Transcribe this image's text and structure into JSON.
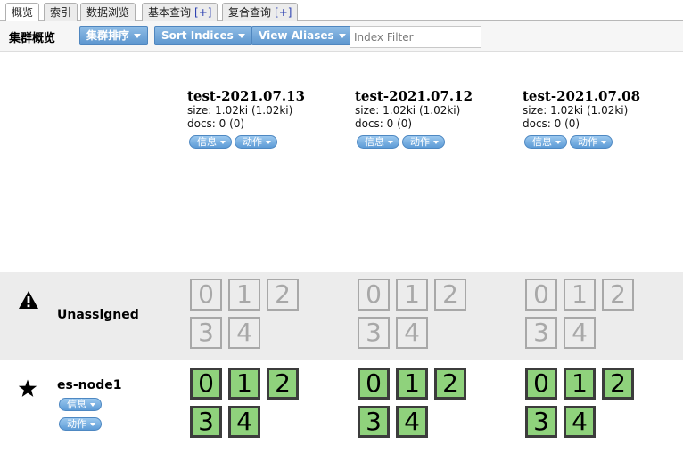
{
  "tabs": [
    {
      "label": "概览",
      "plus": ""
    },
    {
      "label": "索引",
      "plus": ""
    },
    {
      "label": "数据浏览",
      "plus": ""
    },
    {
      "label": "基本查询",
      "plus": "[+]"
    },
    {
      "label": "复合查询",
      "plus": "[+]"
    }
  ],
  "toolbar": {
    "title": "集群概览",
    "sort_cluster": "集群排序",
    "sort_indices": "Sort Indices",
    "view_aliases": "View Aliases",
    "filter_placeholder": "Index Filter"
  },
  "indices": [
    {
      "name": "test-2021.07.13",
      "size": "size: 1.02ki (1.02ki)",
      "docs": "docs: 0 (0)",
      "info": "信息",
      "action": "动作"
    },
    {
      "name": "test-2021.07.12",
      "size": "size: 1.02ki (1.02ki)",
      "docs": "docs: 0 (0)",
      "info": "信息",
      "action": "动作"
    },
    {
      "name": "test-2021.07.08",
      "size": "size: 1.02ki (1.02ki)",
      "docs": "docs: 0 (0)",
      "info": "信息",
      "action": "动作"
    }
  ],
  "rows": {
    "unassigned": {
      "label": "Unassigned",
      "icon": "warning-icon"
    },
    "node": {
      "label": "es-node1",
      "icon": "star-icon",
      "info": "信息",
      "action": "动作"
    }
  },
  "shards": [
    "0",
    "1",
    "2",
    "3",
    "4"
  ],
  "colors": {
    "button": "#5d96cf",
    "shard_assigned": "#8fd27c",
    "shard_unassigned": "#a8a8a8",
    "row_unassigned_bg": "#ececec"
  }
}
